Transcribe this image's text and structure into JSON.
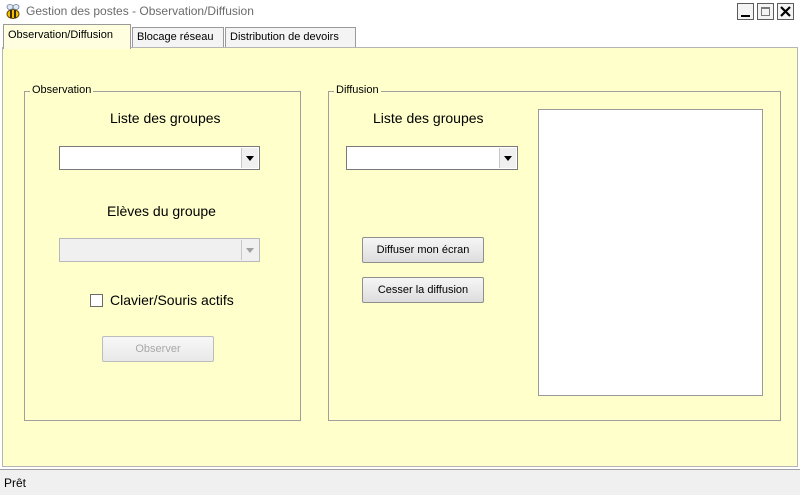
{
  "window": {
    "title": "Gestion des postes - Observation/Diffusion",
    "icon": "bee-icon",
    "controls": [
      "minimize",
      "maximize",
      "close"
    ]
  },
  "tabs": [
    {
      "label": "Observation/Diffusion",
      "active": true
    },
    {
      "label": "Blocage réseau",
      "active": false
    },
    {
      "label": "Distribution de devoirs",
      "active": false
    }
  ],
  "observation": {
    "group_title": "Observation",
    "groups_label": "Liste des groupes",
    "groups_value": "",
    "students_label": "Elèves du groupe",
    "students_value": "",
    "students_enabled": false,
    "keyboard_mouse_label": "Clavier/Souris actifs",
    "keyboard_mouse_checked": false,
    "observe_button": "Observer",
    "observe_enabled": false
  },
  "diffusion": {
    "group_title": "Diffusion",
    "groups_label": "Liste des groupes",
    "groups_value": "",
    "broadcast_button": "Diffuser mon écran",
    "stop_button": "Cesser la diffusion"
  },
  "status": {
    "text": "Prêt"
  },
  "colors": {
    "panel_background": "#ffffcc",
    "active_tab": "#ffffe0",
    "title_text": "#6b6b6b"
  }
}
